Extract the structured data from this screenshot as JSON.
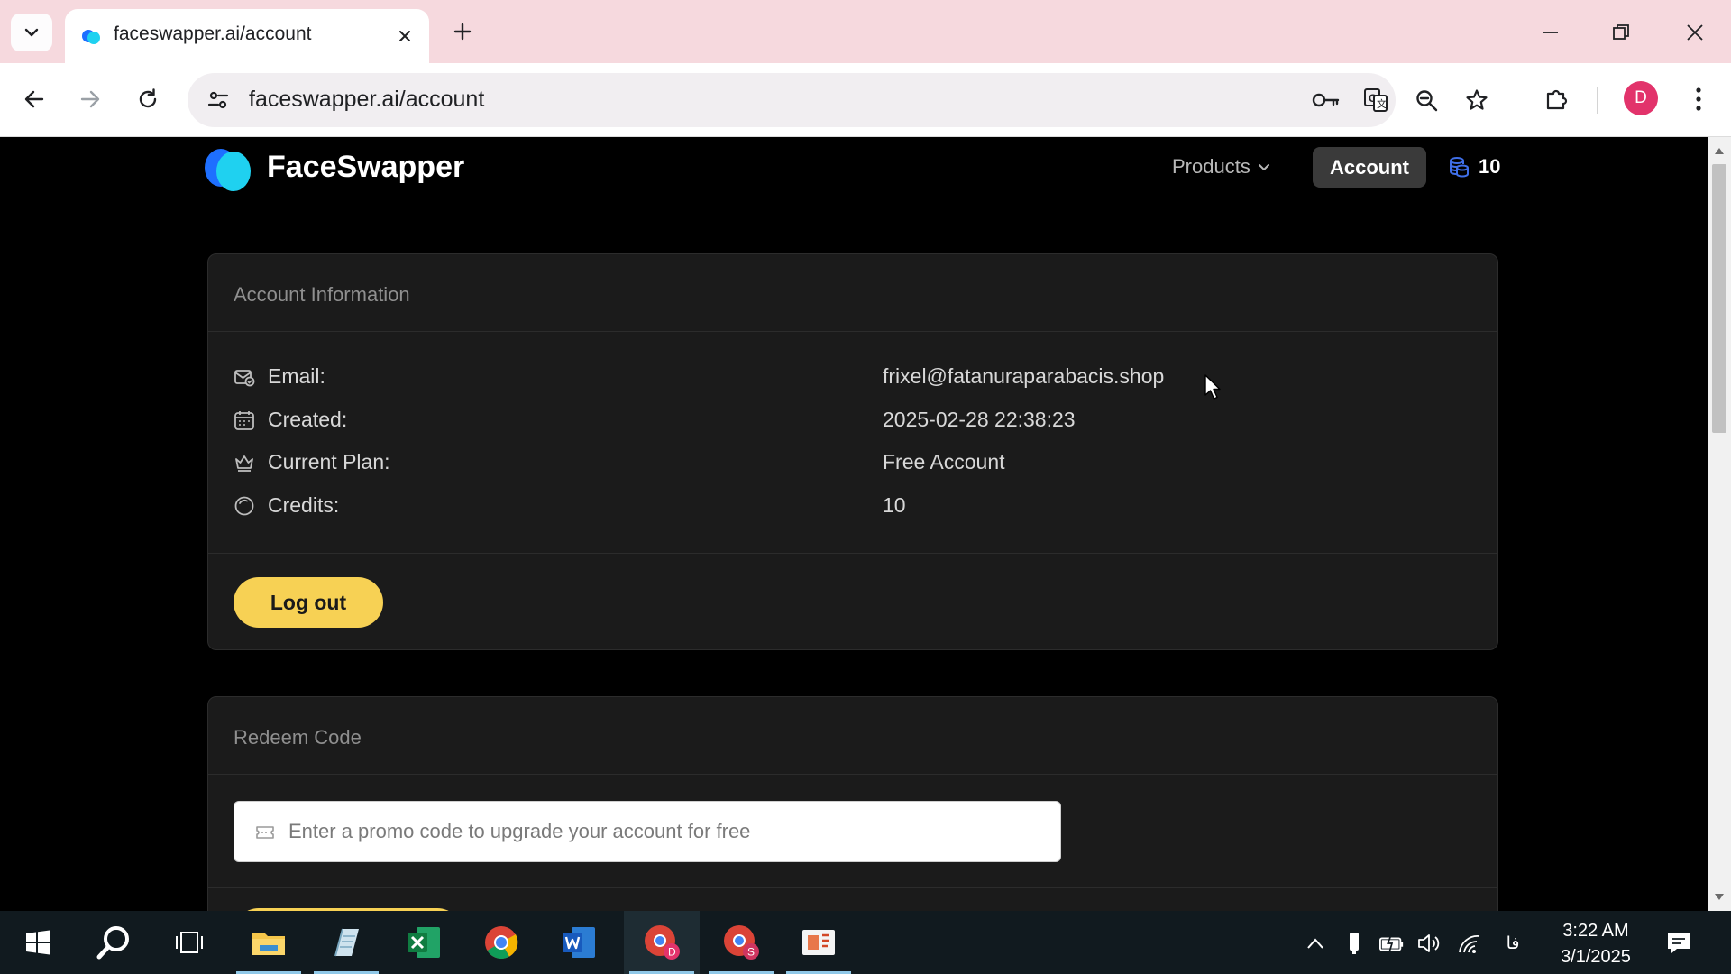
{
  "browser": {
    "tab_title": "faceswapper.ai/account",
    "url": "faceswapper.ai/account",
    "profile_initial": "D"
  },
  "header": {
    "brand": "FaceSwapper",
    "nav_products": "Products",
    "nav_account": "Account",
    "credits_count": "10"
  },
  "account_card": {
    "title": "Account Information",
    "rows": [
      {
        "label": "Email:",
        "value": "frixel@fatanuraparabacis.shop",
        "icon": "email-icon"
      },
      {
        "label": "Created:",
        "value": "2025-02-28 22:38:23",
        "icon": "calendar-icon"
      },
      {
        "label": "Current Plan:",
        "value": "Free Account",
        "icon": "crown-icon"
      },
      {
        "label": "Credits:",
        "value": "10",
        "icon": "credits-icon"
      }
    ],
    "logout_label": "Log out"
  },
  "redeem_card": {
    "title": "Redeem Code",
    "placeholder": "Enter a promo code to upgrade your account for free"
  },
  "taskbar": {
    "time": "3:22 AM",
    "date": "3/1/2025",
    "lang": "فا"
  },
  "colors": {
    "accent_yellow": "#f7d154",
    "tab_strip": "#f6d9de",
    "page_bg": "#000000",
    "card_bg": "#1b1b1b",
    "logo_blue": "#1e90ff",
    "logo_cyan": "#1fd1f0"
  }
}
